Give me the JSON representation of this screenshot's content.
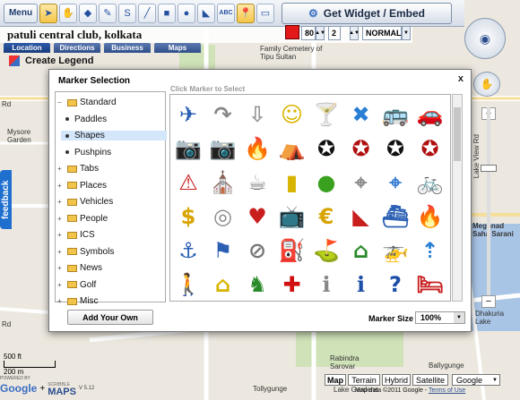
{
  "toolbar": {
    "menu_label": "Menu",
    "widget_label": "Get Widget / Embed",
    "tools": [
      {
        "icon": "pointer-arrow-icon"
      },
      {
        "icon": "hand-icon"
      },
      {
        "icon": "bucket-icon"
      },
      {
        "icon": "pen-icon"
      },
      {
        "icon": "curve-icon"
      },
      {
        "icon": "line-icon"
      },
      {
        "icon": "rectangle-icon"
      },
      {
        "icon": "circle-icon"
      },
      {
        "icon": "polygon-icon"
      },
      {
        "icon": "text-tool-icon",
        "label": "ABC"
      },
      {
        "icon": "marker-icon"
      },
      {
        "icon": "image-icon"
      }
    ],
    "line_width": "80",
    "line_count": "2",
    "line_style": "NORMAL",
    "accent_color": "#e31818"
  },
  "map_title": "patuli central club, kolkata",
  "tabs": [
    "Location",
    "Directions",
    "Business",
    "Maps"
  ],
  "create_legend": "Create Legend",
  "feedback": "feedback",
  "dialog": {
    "title": "Marker Selection",
    "close": "x",
    "hint": "Click Marker to Select",
    "tree": [
      {
        "label": "Standard",
        "type": "folder-open"
      },
      {
        "label": "Paddles",
        "type": "leaf"
      },
      {
        "label": "Shapes",
        "type": "leaf",
        "selected": true
      },
      {
        "label": "Pushpins",
        "type": "leaf"
      },
      {
        "label": "Tabs",
        "type": "folder"
      },
      {
        "label": "Places",
        "type": "folder"
      },
      {
        "label": "Vehicles",
        "type": "folder"
      },
      {
        "label": "People",
        "type": "folder"
      },
      {
        "label": "ICS",
        "type": "folder"
      },
      {
        "label": "Symbols",
        "type": "folder"
      },
      {
        "label": "News",
        "type": "folder"
      },
      {
        "label": "Golf",
        "type": "folder"
      },
      {
        "label": "Misc",
        "type": "folder"
      }
    ],
    "add_button": "Add Your Own",
    "marker_size_label": "Marker Size",
    "marker_size_value": "100%",
    "markers": [
      [
        "airplane-icon",
        "curved-arrow-icon",
        "down-arrow-icon",
        "theater-masks-icon",
        "cocktail-icon",
        "close-box-icon",
        "bus-icon",
        "car-icon"
      ],
      [
        "camera-small-icon",
        "camera-icon",
        "campfire-icon",
        "tent-icon",
        "star-badge-icon",
        "star-badge-red-icon",
        "star-badge-icon",
        "star-badge-red-icon"
      ],
      [
        "warning-icon",
        "church-icon",
        "coffee-cup-icon",
        "milk-bottle-icon",
        "apple-icon",
        "crosshair-grey-icon",
        "crosshair-blue-icon",
        "cyclist-icon",
        "fork-knife-icon"
      ],
      [
        "dollar-icon",
        "ring-icon",
        "heartbeat-icon",
        "tv-icon",
        "euro-icon",
        "earthquake-icon",
        "ship-icon",
        "fire-icon"
      ],
      [
        "fishing-icon",
        "flag-icon",
        "no-sign-icon",
        "fuel-icon",
        "golf-icon",
        "basket-icon",
        "helicopter-icon",
        "highway-icon"
      ],
      [
        "hikers-icon",
        "home-icon",
        "horse-rider-icon",
        "red-cross-icon",
        "info-grey-icon",
        "info-blue-icon",
        "help-icon",
        "bed-icon"
      ]
    ]
  },
  "map": {
    "labels": [
      "Family Cemetery of Tipu Sultan",
      "Mysore Garden",
      "Lake View Rd",
      "Meghnad Saha Sarani",
      "Dhakuria Lake",
      "Rabindra Sarovar",
      "Lake Gardens",
      "Ballygunge",
      "Tollygunge",
      "Rd",
      "Rd"
    ],
    "scale_ft": "500 ft",
    "scale_m": "200 m",
    "powered_by": "POWERED BY",
    "google": "Google",
    "scribble": "SCRIBBLE",
    "maps": "MAPS",
    "version": "V 5.12",
    "copyright": "Map data ©2011 Google -",
    "terms": "Terms of Use",
    "map_types": [
      "Map",
      "Terrain",
      "Hybrid",
      "Satellite",
      "Google"
    ]
  }
}
